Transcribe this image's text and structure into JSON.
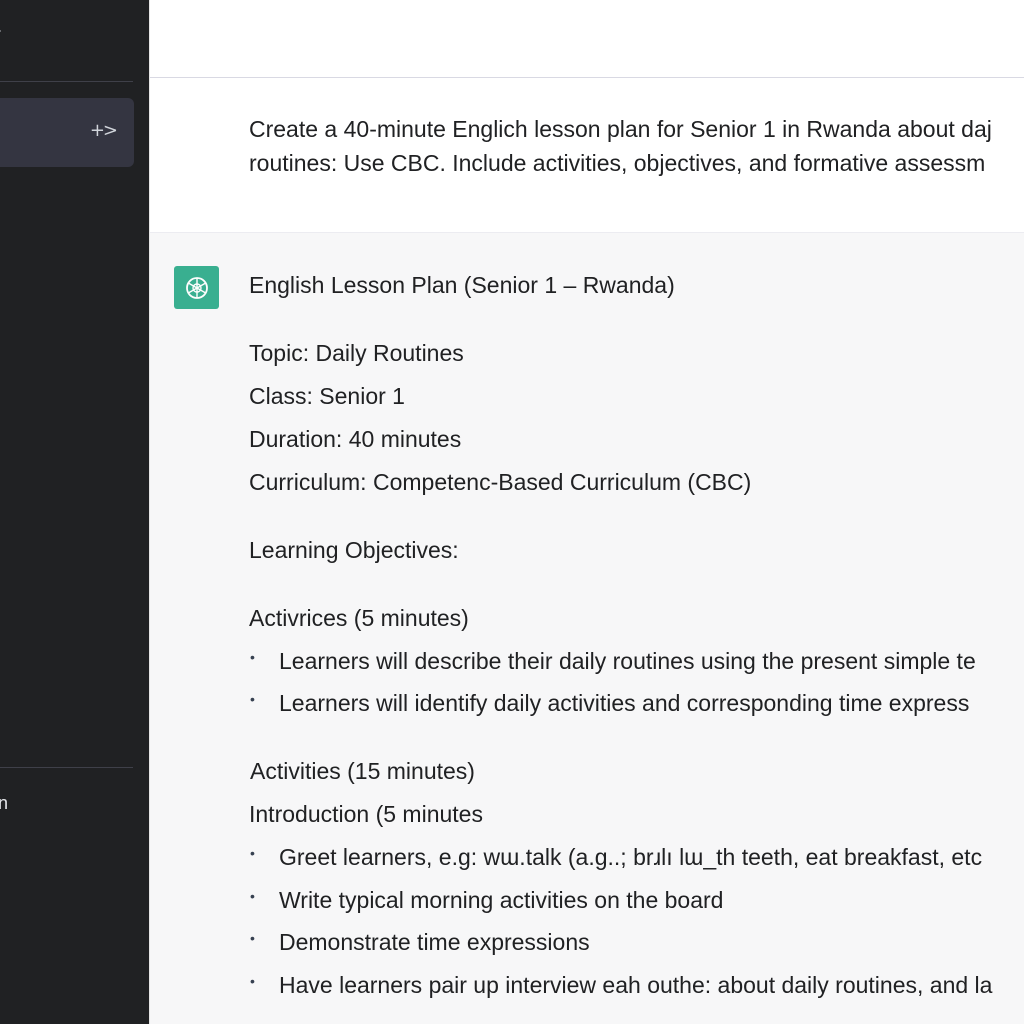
{
  "sidebar": {
    "chevron_glyph": "›",
    "active_item_icon": "+>",
    "bottom_label": "n"
  },
  "user_message": {
    "line1": "Create a 40-minute Englich lesson plan for Senior 1 in Rwanda about daj",
    "line2": "routines: Use CBC. Include activities, objectives, and formative assessm"
  },
  "assistant": {
    "avatar_icon": "openai-logo-icon",
    "title": "English Lesson Plan (Senior 1 – Rwanda)",
    "topic": "Topic: Daily Routines",
    "class": "Class: Senior 1",
    "duration": "Duration: 40 minutes",
    "curriculum": "Curriculum: Competenc-Based Curriculum (CBC)",
    "objectives_heading": "Learning Objectives:",
    "activrices_heading": "Activrices (5 minutes)",
    "objectives": [
      "Learners will describe their daily routines using the present simple te",
      "Learners will identify daily activities and corresponding time express"
    ],
    "activities_heading": "Activities (15 minutes)",
    "introduction_heading": "Introduction (5 minutes",
    "activities": [
      "Greet learners, e.g: wɯ.talk (a.g..; brɹlı lɯ_th teeth, eat breakfast, etc",
      "Write typical morning activities on the board",
      "Demonstrate time expressions",
      "Have learners pair up interview eah outhe: about daily routines, and la"
    ]
  },
  "colors": {
    "sidebar_bg": "#202123",
    "active_item_bg": "#343541",
    "assistant_bg": "#f7f7f8",
    "avatar_green": "#19a37f",
    "text": "#202123"
  }
}
